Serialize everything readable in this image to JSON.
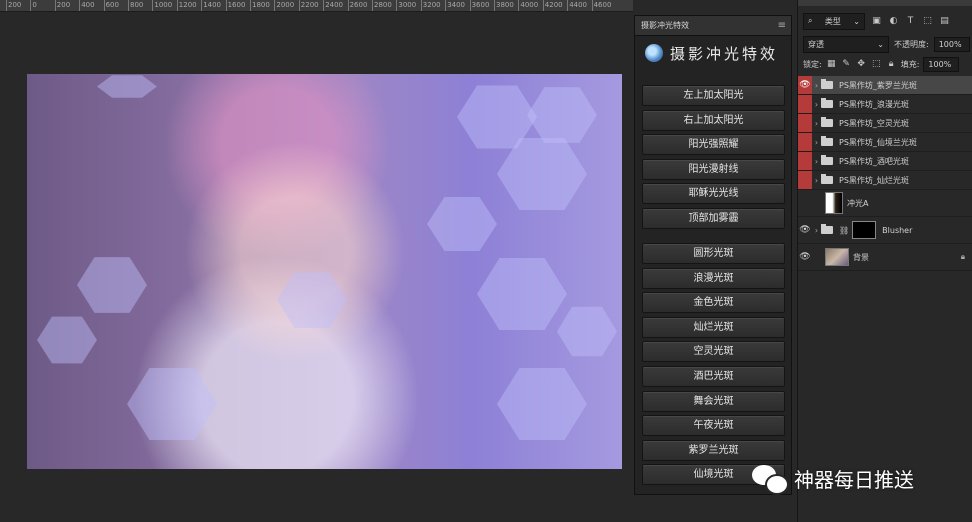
{
  "ruler": {
    "ticks": [
      "200",
      "0",
      "200",
      "400",
      "600",
      "800",
      "1000",
      "1200",
      "1400",
      "1600",
      "1800",
      "2000",
      "2200",
      "2400",
      "2600",
      "2800",
      "3000",
      "3200",
      "3400",
      "3600",
      "3800",
      "4000",
      "4200",
      "4400",
      "4600"
    ]
  },
  "plugin": {
    "tab_title": "摄影冲光特效",
    "menu_icon": "hamburger-menu-icon",
    "header_title": "摄影冲光特效",
    "sunlight_buttons": [
      "左上加太阳光",
      "右上加太阳光",
      "阳光强照耀",
      "阳光漫射线",
      "耶稣光光线",
      "顶部加雾霾"
    ],
    "bokeh_buttons": [
      "圆形光斑",
      "浪漫光斑",
      "金色光斑",
      "灿烂光斑",
      "空灵光斑",
      "酒巴光斑",
      "舞会光斑",
      "午夜光斑",
      "紫罗兰光斑",
      "仙境光斑"
    ]
  },
  "layers_panel": {
    "filter_type": "类型",
    "blend_mode": "穿透",
    "opacity_label": "不透明度:",
    "opacity_value": "100%",
    "lock_label": "锁定:",
    "fill_label": "填充:",
    "fill_value": "100%",
    "groups": [
      {
        "name": "PS黑作坊_紫罗兰光斑",
        "selected": true
      },
      {
        "name": "PS黑作坊_浪漫光斑",
        "selected": false
      },
      {
        "name": "PS黑作坊_空灵光斑",
        "selected": false
      },
      {
        "name": "PS黑作坊_仙境兰光斑",
        "selected": false
      },
      {
        "name": "PS黑作坊_酒吧光斑",
        "selected": false
      },
      {
        "name": "PS黑作坊_灿烂光斑",
        "selected": false
      }
    ],
    "layer_chongguang": "冲光A",
    "layer_blusher": "Blusher",
    "layer_background": "背景"
  },
  "watermark": {
    "text": "神器每日推送"
  },
  "colors": {
    "panel_bg": "#232323",
    "workspace_bg": "#282828",
    "eye_red": "#b53b3b",
    "selected_row": "#474747"
  }
}
